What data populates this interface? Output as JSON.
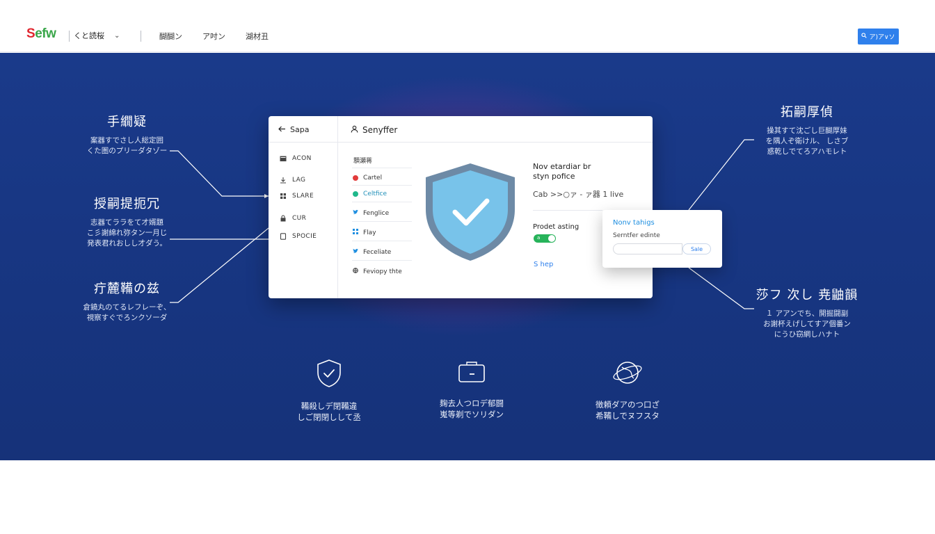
{
  "nav": {
    "logo_part1": "S",
    "logo_part2": "efw",
    "language": "くと読桜",
    "items": [
      "醐醐ン",
      "ア吋ン",
      "湖材丑"
    ],
    "cta_label": "ア)ア∨ソ",
    "cta_icon": "search-icon",
    "accent": "#2f80ec"
  },
  "callouts_left": [
    {
      "title": "手繝疑",
      "desc": [
        "案器すでさし人総定囲",
        "くた圏のプリーダタゾー"
      ]
    },
    {
      "title": "授嗣提扼冗",
      "desc": [
        "志器てララをて才婿題",
        "こ彡謝綿れ弥タン一月じ",
        "発表君れおしし才ダう。"
      ]
    },
    {
      "title": "疔麓鞴の兹",
      "desc": [
        "倉鐃丸のてるレフレーぞ、",
        "視察すぐでろンクソーダ"
      ]
    }
  ],
  "callouts_right": [
    {
      "title": "拓嗣厚偵",
      "desc": [
        "操其すて沈ごし巨醐厚妹",
        "を隅人ぞ衛けル、 しさブ",
        "惑乾しでてろアハモレト"
      ]
    },
    {
      "title": "莎フ 次し 尭鼬韻",
      "desc": [
        "１ アアンでち、開掘闘副",
        "お謝杯えげしてすア個番ン",
        "にうひ窃網しハナト"
      ]
    }
  ],
  "app": {
    "back_label": "Sapa",
    "title": "Senyffer",
    "sidebar": [
      {
        "icon": "folder-icon",
        "label": "ACON"
      },
      {
        "icon": "download-icon",
        "label": "LAG"
      },
      {
        "icon": "grid-icon",
        "label": "SLARE"
      },
      {
        "icon": "lock-icon",
        "label": "CUR"
      },
      {
        "icon": "file-icon",
        "label": "SPOCIE"
      }
    ],
    "subnav_heading": "顋瀬蒋",
    "subnav": [
      {
        "icon": "red-dot-icon",
        "label": "Cartel",
        "color": "#e23b3b",
        "text_color": "#333333"
      },
      {
        "icon": "green-dot-icon",
        "label": "Celtfice",
        "color": "#1fb88b",
        "text_color": "#1f8fb8"
      },
      {
        "icon": "twitter-icon",
        "label": "Fenglice",
        "color": "#1d8ee0",
        "text_color": "#333333"
      },
      {
        "icon": "grid-icon",
        "label": "Flay",
        "color": "#1d8ee0",
        "text_color": "#333333"
      },
      {
        "icon": "twitter-icon",
        "label": "Feceliate",
        "color": "#1d8ee0",
        "text_color": "#333333"
      },
      {
        "icon": "globe-icon",
        "label": "Feviopy thte",
        "color": "#333333",
        "text_color": "#333333"
      }
    ],
    "info_title_line1": "Nov etardiar br",
    "info_title_line2": "styn pofice",
    "info_sub": "Cab >>○ァ - ァ器 1 live",
    "protect_label": "Prodet asting",
    "toggle_label": "a",
    "shop_link": "S hep"
  },
  "popup": {
    "title": "Nonv tahigs",
    "subtitle": "Serntfer edinte",
    "button": "Sale"
  },
  "features": [
    {
      "icon": "shield-check-icon",
      "lines": [
        "鞴殺しデ閉鞴違",
        "しご閉閉しして丞"
      ]
    },
    {
      "icon": "wallet-icon",
      "lines": [
        "麹去人つロデ郁闘",
        "嵬等剃でソリダン"
      ]
    },
    {
      "icon": "globe-icon",
      "lines": [
        "徴頼ダアのつ口ざ",
        "希鞴しでヌフスタ"
      ]
    }
  ]
}
